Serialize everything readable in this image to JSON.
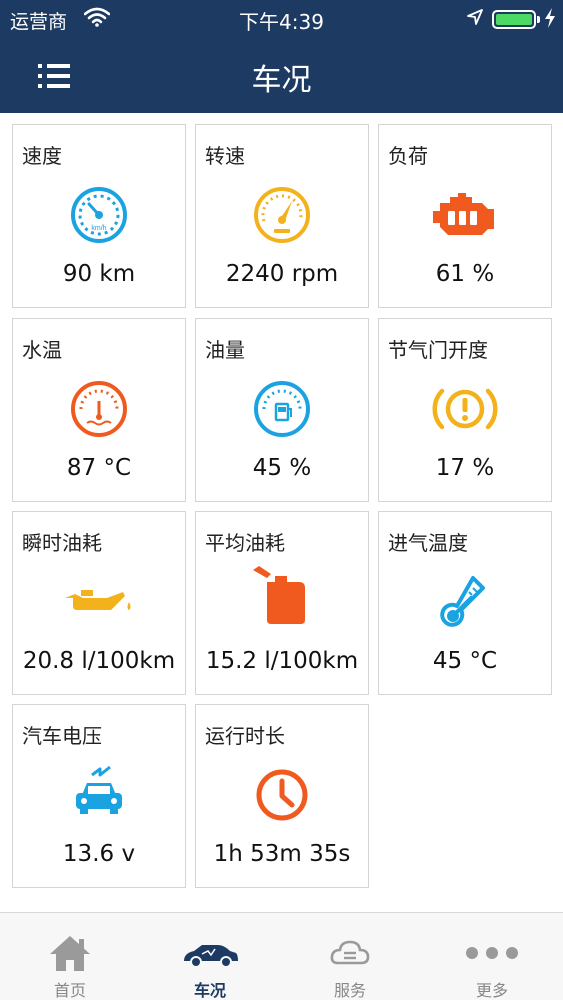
{
  "status_bar": {
    "carrier": "运营商",
    "time": "下午4:39"
  },
  "header": {
    "title": "车况"
  },
  "cards": [
    {
      "label": "速度",
      "value": "90 km",
      "icon": "speedometer-icon",
      "color": "#1aa3e0"
    },
    {
      "label": "转速",
      "value": "2240 rpm",
      "icon": "tachometer-icon",
      "color": "#f3b21b"
    },
    {
      "label": "负荷",
      "value": "61 %",
      "icon": "engine-icon",
      "color": "#f05a1e"
    },
    {
      "label": "水温",
      "value": "87 °C",
      "icon": "coolant-gauge-icon",
      "color": "#f05a1e"
    },
    {
      "label": "油量",
      "value": "45 %",
      "icon": "fuel-gauge-icon",
      "color": "#1aa3e0"
    },
    {
      "label": "节气门开度",
      "value": "17 %",
      "icon": "throttle-warning-icon",
      "color": "#f3b21b"
    },
    {
      "label": "瞬时油耗",
      "value": "20.8  l/100km",
      "icon": "oil-can-icon",
      "color": "#f3b21b"
    },
    {
      "label": "平均油耗",
      "value": "15.2  l/100km",
      "icon": "fuel-jerrycan-icon",
      "color": "#f05a1e"
    },
    {
      "label": "进气温度",
      "value": "45 °C",
      "icon": "thermometer-icon",
      "color": "#1aa3e0"
    },
    {
      "label": "汽车电压",
      "value": "13.6 v",
      "icon": "car-voltage-icon",
      "color": "#1aa3e0"
    },
    {
      "label": "运行时长",
      "value": "1h  53m  35s",
      "icon": "clock-icon",
      "color": "#f05a1e"
    }
  ],
  "tabs": [
    {
      "label": "首页",
      "icon": "home-icon"
    },
    {
      "label": "车况",
      "icon": "car-icon",
      "active": true
    },
    {
      "label": "服务",
      "icon": "cloud-service-icon"
    },
    {
      "label": "更多",
      "icon": "more-dots-icon"
    }
  ],
  "colors": {
    "header_bg": "#1d3a63",
    "battery": "#4cd964",
    "tab_inactive": "#888888",
    "tab_active": "#1d3a63"
  }
}
